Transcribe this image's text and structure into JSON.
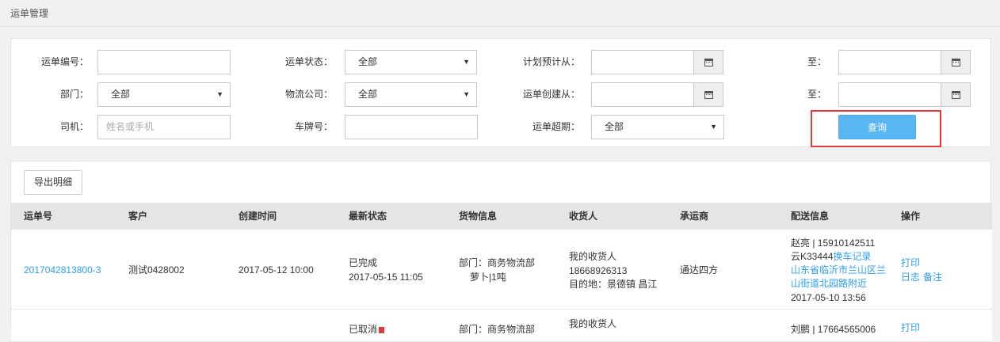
{
  "breadcrumb": "运单管理",
  "filters": {
    "waybill_no_label": "运单编号：",
    "waybill_status_label": "运单状态：",
    "waybill_status_value": "全部",
    "plan_from_label": "计划预计从：",
    "to_label": "至：",
    "dept_label": "部门：",
    "dept_value": "全部",
    "logistics_label": "物流公司：",
    "logistics_value": "全部",
    "create_from_label": "运单创建从：",
    "to2_label": "至：",
    "driver_label": "司机：",
    "driver_placeholder": "姓名或手机",
    "plate_label": "车牌号：",
    "overdue_label": "运单超期：",
    "overdue_value": "全部",
    "query_label": "查询",
    "dropdown_arrow": "▼"
  },
  "list": {
    "export_label": "导出明细",
    "columns": [
      "运单号",
      "客户",
      "创建时间",
      "最新状态",
      "货物信息",
      "收货人",
      "承运商",
      "配送信息",
      "操作"
    ],
    "rows": [
      {
        "waybill_no": "2017042813800-3",
        "customer": "测试0428002",
        "created": "2017-05-12 10:00",
        "status": "已完成",
        "status_time": "2017-05-15 11:05",
        "goods_dept": "部门：商务物流部",
        "goods_item": "萝卜|1吨",
        "receiver_name": "我的收货人",
        "receiver_phone": "18668926313",
        "receiver_dest": "目的地：景德镇 昌江",
        "carrier": "通达四方",
        "delivery_driver": "赵亮 | 15910142511",
        "delivery_plate": "云K33444",
        "delivery_change": "换车记录",
        "delivery_loc1": "山东省临沂市兰山区兰",
        "delivery_loc2": "山街道北园路附近",
        "delivery_time": "2017-05-10 13:56",
        "op_print": "打印",
        "op_log": "日志",
        "op_note": "备注"
      },
      {
        "status": "已取消",
        "goods_dept": "部门：商务物流部",
        "receiver_name": "我的收货人",
        "delivery_driver": "刘鹏 | 17664565006",
        "op_print": "打印"
      }
    ]
  }
}
